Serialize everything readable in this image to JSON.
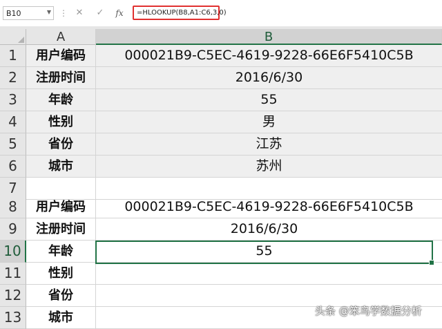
{
  "formula_bar": {
    "name_box": "B10",
    "dropdown_icon": "chevron-down-icon",
    "cancel_icon": "close-icon",
    "enter_icon": "check-icon",
    "fx_label": "fx",
    "formula": "=HLOOKUP(B8,A1:C6,3,0)"
  },
  "columns": [
    {
      "label": "A"
    },
    {
      "label": "B"
    }
  ],
  "rows": [
    {
      "num": "1",
      "a": "用户编码",
      "b": "000021B9-C5EC-4619-9228-66E6F5410C5B"
    },
    {
      "num": "2",
      "a": "注册时间",
      "b": "2016/6/30"
    },
    {
      "num": "3",
      "a": "年龄",
      "b": "55"
    },
    {
      "num": "4",
      "a": "性别",
      "b": "男"
    },
    {
      "num": "5",
      "a": "省份",
      "b": "江苏"
    },
    {
      "num": "6",
      "a": "城市",
      "b": "苏州"
    },
    {
      "num": "7",
      "a": "",
      "b": ""
    },
    {
      "num": "8",
      "a": "用户编码",
      "b": "000021B9-C5EC-4619-9228-66E6F5410C5B"
    },
    {
      "num": "9",
      "a": "注册时间",
      "b": "2016/6/30"
    },
    {
      "num": "10",
      "a": "年龄",
      "b": "55"
    },
    {
      "num": "11",
      "a": "性别",
      "b": ""
    },
    {
      "num": "12",
      "a": "省份",
      "b": ""
    },
    {
      "num": "13",
      "a": "城市",
      "b": ""
    }
  ],
  "colors": {
    "selection": "#217346",
    "formula_highlight": "#e0302f",
    "shaded_range": "#efefef"
  },
  "watermark": "头条 @笨鸟学数据分析"
}
